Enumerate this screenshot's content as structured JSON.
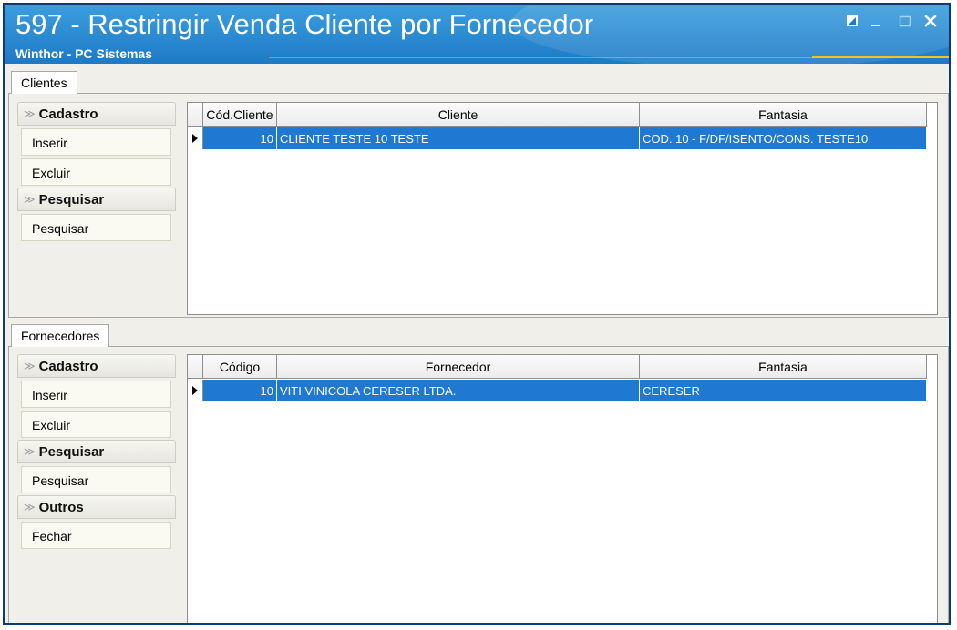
{
  "window": {
    "title": "597 - Restringir Venda Cliente por Fornecedor",
    "subtitle": "Winthor - PC Sistemas",
    "controls": [
      "restore-icon",
      "minimize-icon",
      "maximize-icon",
      "close-icon"
    ]
  },
  "clientes": {
    "tab_label": "Clientes",
    "groups": [
      {
        "title": "Cadastro",
        "items": [
          "Inserir",
          "Excluir"
        ]
      },
      {
        "title": "Pesquisar",
        "items": [
          "Pesquisar"
        ]
      }
    ],
    "columns": [
      "Cód.Cliente",
      "Cliente",
      "Fantasia"
    ],
    "rows": [
      {
        "codigo": "10",
        "cliente": "CLIENTE TESTE 10 TESTE",
        "fantasia": "COD. 10 - F/DF/ISENTO/CONS. TESTE10"
      }
    ]
  },
  "fornecedores": {
    "tab_label": "Fornecedores",
    "groups": [
      {
        "title": "Cadastro",
        "items": [
          "Inserir",
          "Excluir"
        ]
      },
      {
        "title": "Pesquisar",
        "items": [
          "Pesquisar"
        ]
      },
      {
        "title": "Outros",
        "items": [
          "Fechar"
        ]
      }
    ],
    "columns": [
      "Código",
      "Fornecedor",
      "Fantasia"
    ],
    "rows": [
      {
        "codigo": "10",
        "fornecedor": "VITI VINICOLA CERESER LTDA.",
        "fantasia": "CERESER"
      }
    ]
  },
  "colors": {
    "title_bar": "#1d7ac6",
    "selected_row": "#1f79d3",
    "accent": "#f7c218"
  }
}
